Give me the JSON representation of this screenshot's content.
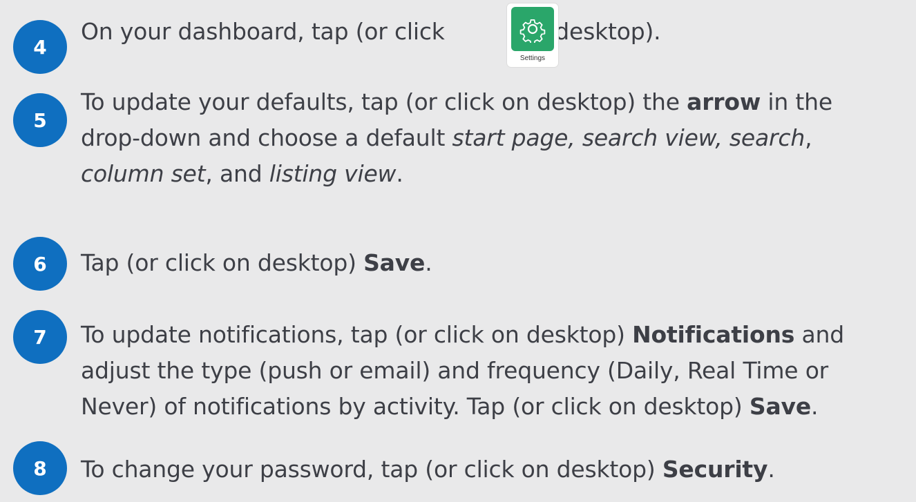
{
  "steps": [
    {
      "number": "4",
      "parts": {
        "a": "On your dashboard, tap (or click ",
        "b": " on desktop)."
      },
      "settings_tile": {
        "label": "Settings",
        "icon": "gear-icon",
        "color": "#2aa66a"
      }
    },
    {
      "number": "5",
      "lines": [
        {
          "a": "To update your defaults, tap (or click on desktop) the ",
          "b_bold": "arrow",
          "c": " in the"
        },
        {
          "a": "drop-down and choose a default ",
          "b_italic": "start page, search view, search",
          "c": ","
        },
        {
          "a_italic": "column set",
          "b": ", and ",
          "c_italic": "listing view",
          "d": "."
        }
      ]
    },
    {
      "number": "6",
      "line": {
        "a": "Tap (or click on desktop) ",
        "b_bold": "Save",
        "c": "."
      }
    },
    {
      "number": "7",
      "lines": [
        {
          "a": "To update notifications, tap (or click on desktop) ",
          "b_bold": "Notifications",
          "c": " and"
        },
        {
          "a": "adjust the type (push or email) and frequency (Daily, Real Time or"
        },
        {
          "a": "Never) of notifications by activity. Tap (or click on desktop) ",
          "b_bold": "Save",
          "c": "."
        }
      ]
    },
    {
      "number": "8",
      "line": {
        "a": "To change your password, tap (or click on desktop) ",
        "b_bold": "Security",
        "c": "."
      }
    }
  ],
  "colors": {
    "background": "#e9e9ea",
    "badge": "#0f6fc0",
    "text": "#3d3f46"
  }
}
